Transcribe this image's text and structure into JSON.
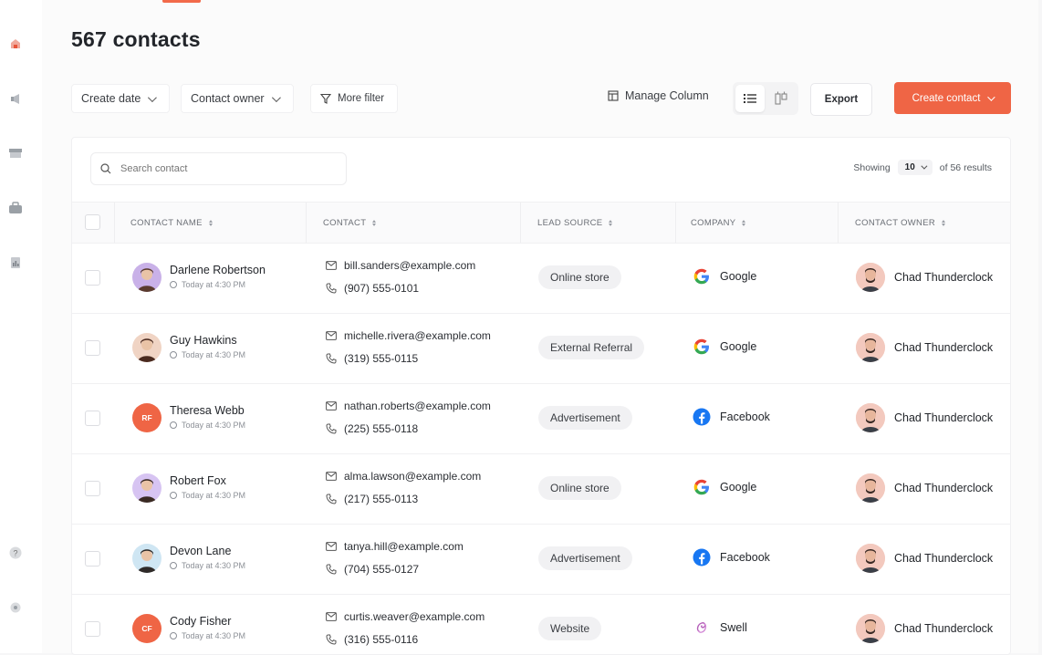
{
  "page": {
    "title": "567 contacts"
  },
  "filters": {
    "create_date": "Create date",
    "contact_owner": "Contact owner",
    "more_filter": "More filter",
    "manage_column": "Manage Column",
    "export": "Export",
    "create_contact": "Create contact"
  },
  "table": {
    "search_placeholder": "Search contact",
    "showing_label": "Showing",
    "per_page": "10",
    "results_label": "of 56 results",
    "headers": [
      "CONTACT NAME",
      "CONTACT",
      "LEAD SOURCE",
      "COMPANY",
      "CONTACT OWNER"
    ],
    "rows": [
      {
        "name": "Darlene Robertson",
        "time": "Today at 4:30 PM",
        "email": "bill.sanders@example.com",
        "phone": "(907) 555-0101",
        "lead": "Online store",
        "company": "Google",
        "company_icon": "google-icon",
        "owner": "Chad Thunderclock",
        "avatar": "photo"
      },
      {
        "name": "Guy Hawkins",
        "time": "Today at 4:30 PM",
        "email": "michelle.rivera@example.com",
        "phone": "(319) 555-0115",
        "lead": "External Referral",
        "company": "Google",
        "company_icon": "google-icon",
        "owner": "Chad Thunderclock",
        "avatar": "photo"
      },
      {
        "name": "Theresa Webb",
        "time": "Today at 4:30 PM",
        "email": "nathan.roberts@example.com",
        "phone": "(225) 555-0118",
        "lead": "Advertisement",
        "company": "Facebook",
        "company_icon": "facebook-icon",
        "owner": "Chad Thunderclock",
        "avatar": "initials",
        "initials": "RF"
      },
      {
        "name": "Robert Fox",
        "time": "Today at 4:30 PM",
        "email": "alma.lawson@example.com",
        "phone": "(217) 555-0113",
        "lead": "Online store",
        "company": "Google",
        "company_icon": "google-icon",
        "owner": "Chad Thunderclock",
        "avatar": "photo"
      },
      {
        "name": "Devon Lane",
        "time": "Today at 4:30 PM",
        "email": "tanya.hill@example.com",
        "phone": "(704) 555-0127",
        "lead": "Advertisement",
        "company": "Facebook",
        "company_icon": "facebook-icon",
        "owner": "Chad Thunderclock",
        "avatar": "photo"
      },
      {
        "name": "Cody Fisher",
        "time": "Today at 4:30 PM",
        "email": "curtis.weaver@example.com",
        "phone": "(316) 555-0116",
        "lead": "Website",
        "company": "Swell",
        "company_icon": "swell-icon",
        "owner": "Chad Thunderclock",
        "avatar": "initials",
        "initials": "CF"
      }
    ]
  },
  "colors": {
    "accent": "#ef6545",
    "google_blue": "#4285F4",
    "facebook_blue": "#1877F2"
  }
}
